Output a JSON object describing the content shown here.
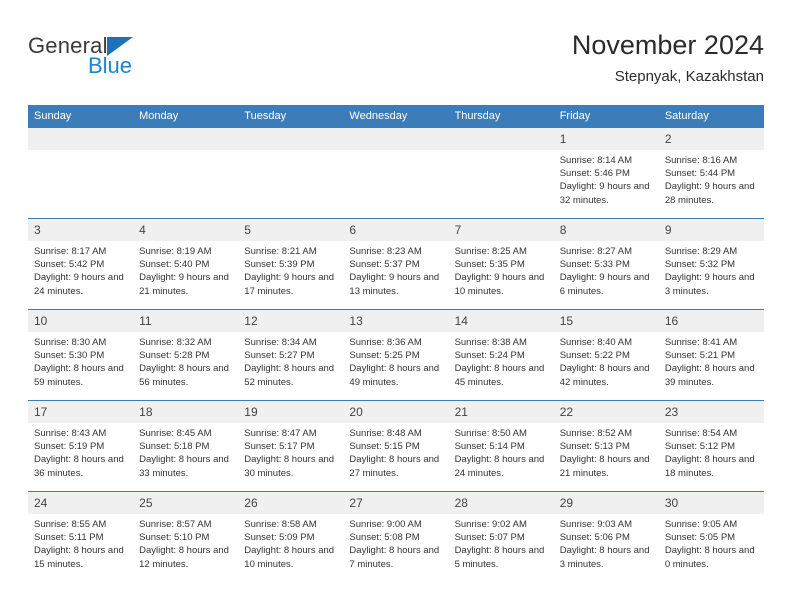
{
  "brand": {
    "name_top": "General",
    "name_bottom": "Blue",
    "accent_color": "#1b72b8",
    "blue_text_color": "#1b86d4"
  },
  "header": {
    "title": "November 2024",
    "subtitle": "Stepnyak, Kazakhstan"
  },
  "theme": {
    "header_row_bg": "#3c7cb8",
    "daynum_bg": "#f0f0f0",
    "grid_line": "#3c7cb8"
  },
  "weekdays": [
    "Sunday",
    "Monday",
    "Tuesday",
    "Wednesday",
    "Thursday",
    "Friday",
    "Saturday"
  ],
  "weeks": [
    [
      {
        "day": "",
        "sunrise": "",
        "sunset": "",
        "daylight": ""
      },
      {
        "day": "",
        "sunrise": "",
        "sunset": "",
        "daylight": ""
      },
      {
        "day": "",
        "sunrise": "",
        "sunset": "",
        "daylight": ""
      },
      {
        "day": "",
        "sunrise": "",
        "sunset": "",
        "daylight": ""
      },
      {
        "day": "",
        "sunrise": "",
        "sunset": "",
        "daylight": ""
      },
      {
        "day": "1",
        "sunrise": "Sunrise: 8:14 AM",
        "sunset": "Sunset: 5:46 PM",
        "daylight": "Daylight: 9 hours and 32 minutes."
      },
      {
        "day": "2",
        "sunrise": "Sunrise: 8:16 AM",
        "sunset": "Sunset: 5:44 PM",
        "daylight": "Daylight: 9 hours and 28 minutes."
      }
    ],
    [
      {
        "day": "3",
        "sunrise": "Sunrise: 8:17 AM",
        "sunset": "Sunset: 5:42 PM",
        "daylight": "Daylight: 9 hours and 24 minutes."
      },
      {
        "day": "4",
        "sunrise": "Sunrise: 8:19 AM",
        "sunset": "Sunset: 5:40 PM",
        "daylight": "Daylight: 9 hours and 21 minutes."
      },
      {
        "day": "5",
        "sunrise": "Sunrise: 8:21 AM",
        "sunset": "Sunset: 5:39 PM",
        "daylight": "Daylight: 9 hours and 17 minutes."
      },
      {
        "day": "6",
        "sunrise": "Sunrise: 8:23 AM",
        "sunset": "Sunset: 5:37 PM",
        "daylight": "Daylight: 9 hours and 13 minutes."
      },
      {
        "day": "7",
        "sunrise": "Sunrise: 8:25 AM",
        "sunset": "Sunset: 5:35 PM",
        "daylight": "Daylight: 9 hours and 10 minutes."
      },
      {
        "day": "8",
        "sunrise": "Sunrise: 8:27 AM",
        "sunset": "Sunset: 5:33 PM",
        "daylight": "Daylight: 9 hours and 6 minutes."
      },
      {
        "day": "9",
        "sunrise": "Sunrise: 8:29 AM",
        "sunset": "Sunset: 5:32 PM",
        "daylight": "Daylight: 9 hours and 3 minutes."
      }
    ],
    [
      {
        "day": "10",
        "sunrise": "Sunrise: 8:30 AM",
        "sunset": "Sunset: 5:30 PM",
        "daylight": "Daylight: 8 hours and 59 minutes."
      },
      {
        "day": "11",
        "sunrise": "Sunrise: 8:32 AM",
        "sunset": "Sunset: 5:28 PM",
        "daylight": "Daylight: 8 hours and 56 minutes."
      },
      {
        "day": "12",
        "sunrise": "Sunrise: 8:34 AM",
        "sunset": "Sunset: 5:27 PM",
        "daylight": "Daylight: 8 hours and 52 minutes."
      },
      {
        "day": "13",
        "sunrise": "Sunrise: 8:36 AM",
        "sunset": "Sunset: 5:25 PM",
        "daylight": "Daylight: 8 hours and 49 minutes."
      },
      {
        "day": "14",
        "sunrise": "Sunrise: 8:38 AM",
        "sunset": "Sunset: 5:24 PM",
        "daylight": "Daylight: 8 hours and 45 minutes."
      },
      {
        "day": "15",
        "sunrise": "Sunrise: 8:40 AM",
        "sunset": "Sunset: 5:22 PM",
        "daylight": "Daylight: 8 hours and 42 minutes."
      },
      {
        "day": "16",
        "sunrise": "Sunrise: 8:41 AM",
        "sunset": "Sunset: 5:21 PM",
        "daylight": "Daylight: 8 hours and 39 minutes."
      }
    ],
    [
      {
        "day": "17",
        "sunrise": "Sunrise: 8:43 AM",
        "sunset": "Sunset: 5:19 PM",
        "daylight": "Daylight: 8 hours and 36 minutes."
      },
      {
        "day": "18",
        "sunrise": "Sunrise: 8:45 AM",
        "sunset": "Sunset: 5:18 PM",
        "daylight": "Daylight: 8 hours and 33 minutes."
      },
      {
        "day": "19",
        "sunrise": "Sunrise: 8:47 AM",
        "sunset": "Sunset: 5:17 PM",
        "daylight": "Daylight: 8 hours and 30 minutes."
      },
      {
        "day": "20",
        "sunrise": "Sunrise: 8:48 AM",
        "sunset": "Sunset: 5:15 PM",
        "daylight": "Daylight: 8 hours and 27 minutes."
      },
      {
        "day": "21",
        "sunrise": "Sunrise: 8:50 AM",
        "sunset": "Sunset: 5:14 PM",
        "daylight": "Daylight: 8 hours and 24 minutes."
      },
      {
        "day": "22",
        "sunrise": "Sunrise: 8:52 AM",
        "sunset": "Sunset: 5:13 PM",
        "daylight": "Daylight: 8 hours and 21 minutes."
      },
      {
        "day": "23",
        "sunrise": "Sunrise: 8:54 AM",
        "sunset": "Sunset: 5:12 PM",
        "daylight": "Daylight: 8 hours and 18 minutes."
      }
    ],
    [
      {
        "day": "24",
        "sunrise": "Sunrise: 8:55 AM",
        "sunset": "Sunset: 5:11 PM",
        "daylight": "Daylight: 8 hours and 15 minutes."
      },
      {
        "day": "25",
        "sunrise": "Sunrise: 8:57 AM",
        "sunset": "Sunset: 5:10 PM",
        "daylight": "Daylight: 8 hours and 12 minutes."
      },
      {
        "day": "26",
        "sunrise": "Sunrise: 8:58 AM",
        "sunset": "Sunset: 5:09 PM",
        "daylight": "Daylight: 8 hours and 10 minutes."
      },
      {
        "day": "27",
        "sunrise": "Sunrise: 9:00 AM",
        "sunset": "Sunset: 5:08 PM",
        "daylight": "Daylight: 8 hours and 7 minutes."
      },
      {
        "day": "28",
        "sunrise": "Sunrise: 9:02 AM",
        "sunset": "Sunset: 5:07 PM",
        "daylight": "Daylight: 8 hours and 5 minutes."
      },
      {
        "day": "29",
        "sunrise": "Sunrise: 9:03 AM",
        "sunset": "Sunset: 5:06 PM",
        "daylight": "Daylight: 8 hours and 3 minutes."
      },
      {
        "day": "30",
        "sunrise": "Sunrise: 9:05 AM",
        "sunset": "Sunset: 5:05 PM",
        "daylight": "Daylight: 8 hours and 0 minutes."
      }
    ]
  ]
}
